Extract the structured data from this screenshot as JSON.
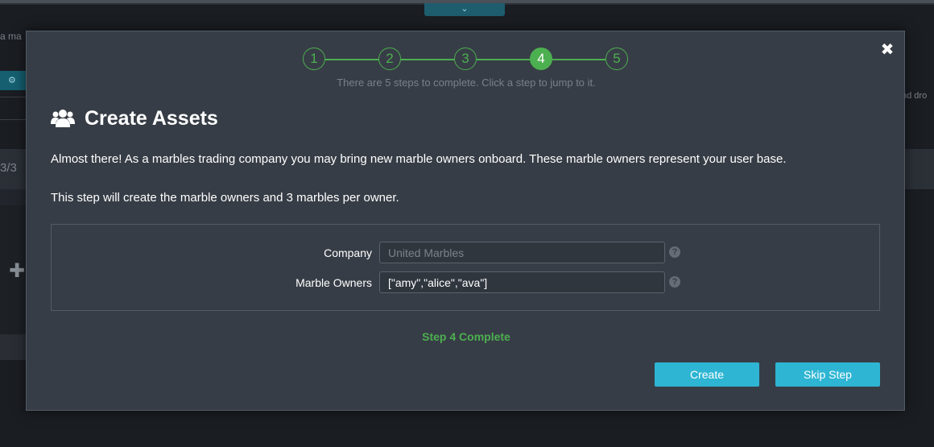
{
  "background": {
    "left_text": "a ma",
    "count_text": "3/3",
    "right_text": "nd dro",
    "tab_handle_icon": "chevron-down-icon",
    "chip_icon": "gear-icon",
    "plus_icon": "plus-icon"
  },
  "modal": {
    "close_icon": "close-icon",
    "stepper": {
      "steps": [
        "1",
        "2",
        "3",
        "4",
        "5"
      ],
      "active_step": "4",
      "hint": "There are 5 steps to complete. Click a step to jump to it."
    },
    "title_icon": "users-icon",
    "title": "Create Assets",
    "paragraph1": "Almost there! As a marbles trading company you may bring new marble owners onboard. These marble owners represent your user base.",
    "paragraph2": "This step will create the marble owners and 3 marbles per owner.",
    "form": {
      "company": {
        "label": "Company",
        "value": "",
        "placeholder": "United Marbles",
        "help_icon": "question-circle-icon"
      },
      "owners": {
        "label": "Marble Owners",
        "value": "[\"amy\",\"alice\",\"ava\"]",
        "placeholder": "",
        "help_icon": "question-circle-icon"
      }
    },
    "status": "Step 4 Complete",
    "buttons": {
      "create": "Create",
      "skip": "Skip Step"
    },
    "colors": {
      "accent_green": "#4caf50",
      "button_blue": "#2eb5d3",
      "modal_bg": "#373d46"
    }
  }
}
